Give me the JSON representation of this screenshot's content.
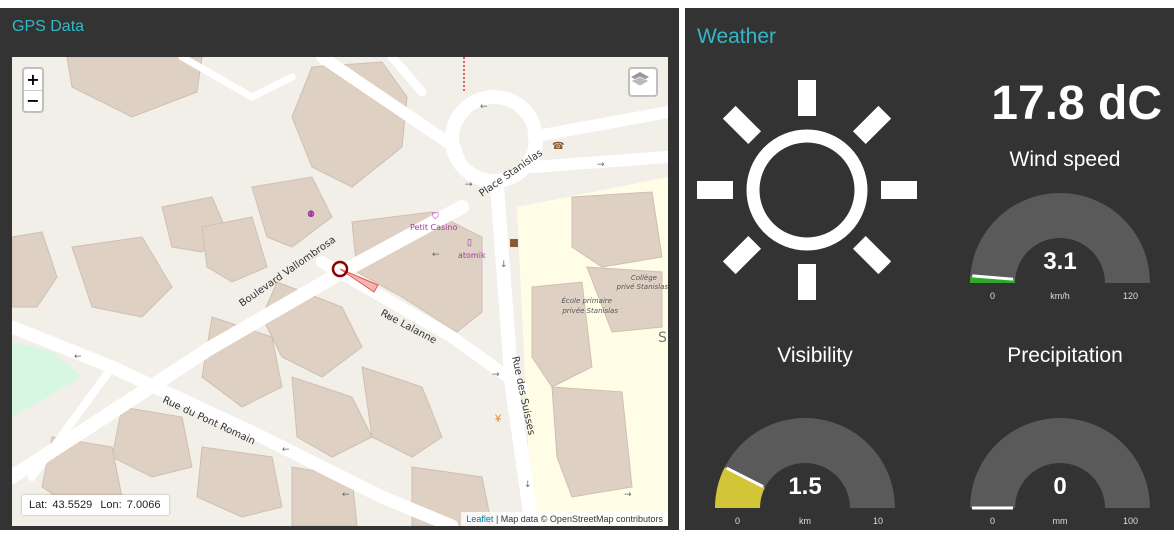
{
  "gps": {
    "title": "GPS Data",
    "zoom_in": "+",
    "zoom_out": "−",
    "coords": {
      "lat_label": "Lat:",
      "lat": "43.5529",
      "lon_label": "Lon:",
      "lon": "7.0066"
    },
    "attribution": {
      "leaflet": "Leaflet",
      "rest": "| Map data © OpenStreetMap contributors"
    },
    "streets": [
      "Place Stanislas",
      "Boulevard Vallombrosa",
      "Rue Lalanne",
      "Rue des Suisses",
      "Rue du Pont Romain"
    ],
    "pois": [
      "Petit Casino",
      "atomik"
    ],
    "schools": [
      "Collège",
      "privé Stanislas",
      "École primaire",
      "privée Stanislas"
    ],
    "edge_letter": "S"
  },
  "weather": {
    "title": "Weather",
    "condition_icon": "sun-icon",
    "temperature": "17.8 dC",
    "gauges": [
      {
        "title": "Wind speed",
        "value": 3.1,
        "display": "3.1",
        "unit": "km/h",
        "min": 0,
        "max": 120,
        "min_label": "0",
        "max_label": "120",
        "color": "#2ea82e"
      },
      {
        "title": "Visibility",
        "value": 1.5,
        "display": "1.5",
        "unit": "km",
        "min": 0,
        "max": 10,
        "min_label": "0",
        "max_label": "10",
        "color": "#d2c538"
      },
      {
        "title": "Precipitation",
        "value": 0,
        "display": "0",
        "unit": "mm",
        "min": 0,
        "max": 100,
        "min_label": "0",
        "max_label": "100",
        "color": "#aaaaaa"
      }
    ]
  },
  "colors": {
    "panel": "#333333",
    "accent": "#32b8c6",
    "gauge_track": "#5a5a5a"
  }
}
